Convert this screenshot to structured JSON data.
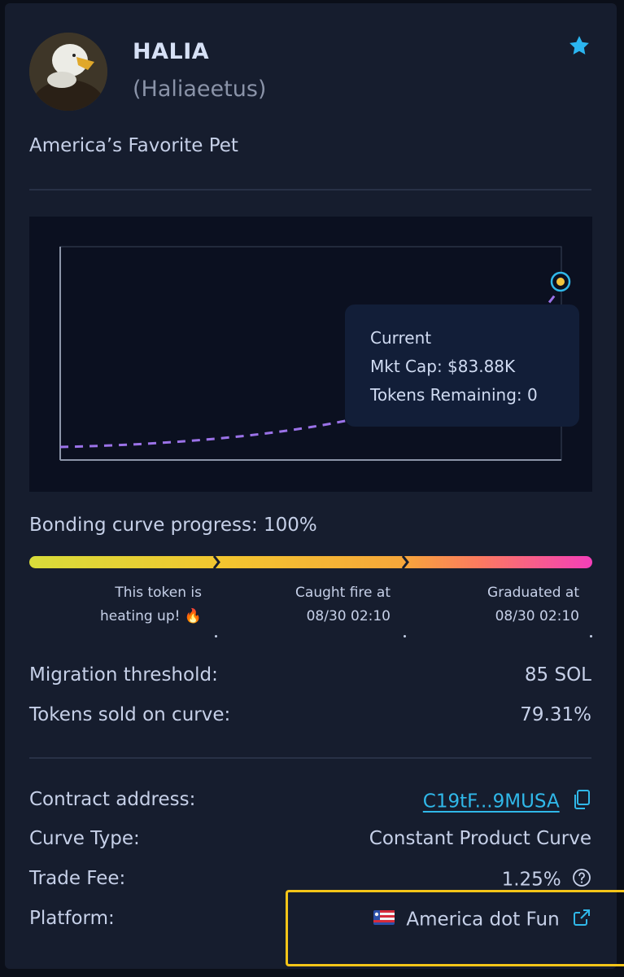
{
  "token": {
    "symbol": "HALIA",
    "name": "(Haliaeetus)",
    "description": "America’s Favorite Pet"
  },
  "chart": {
    "tooltip": {
      "line1": "Current",
      "line2": "Mkt Cap: $83.88K",
      "line3": "Tokens Remaining: 0"
    }
  },
  "progress": {
    "label": "Bonding curve progress: 100%",
    "value_percent": 100,
    "milestones": [
      {
        "line1": "This token is",
        "line2": "heating up! 🔥"
      },
      {
        "line1": "Caught fire at",
        "line2": "08/30 02:10"
      },
      {
        "line1": "Graduated at",
        "line2": "08/30 02:10"
      }
    ]
  },
  "stats": {
    "migration_threshold": {
      "label": "Migration threshold:",
      "value": "85 SOL"
    },
    "tokens_sold": {
      "label": "Tokens sold on curve:",
      "value": "79.31%"
    }
  },
  "details": {
    "contract": {
      "label": "Contract address:",
      "value": "C19tF...9MUSA"
    },
    "curve_type": {
      "label": "Curve Type:",
      "value": "Constant Product Curve"
    },
    "trade_fee": {
      "label": "Trade Fee:",
      "value": "1.25%"
    },
    "platform": {
      "label": "Platform:",
      "value": "America dot Fun"
    }
  },
  "colors": {
    "accent_link": "#30b8e9",
    "star": "#2bb5f0",
    "curve": "#9b72e8",
    "highlight": "#f5c518"
  },
  "icons": [
    "star-icon",
    "copy-icon",
    "help-icon",
    "external-link-icon",
    "platform-flag-icon",
    "fire-emoji"
  ]
}
